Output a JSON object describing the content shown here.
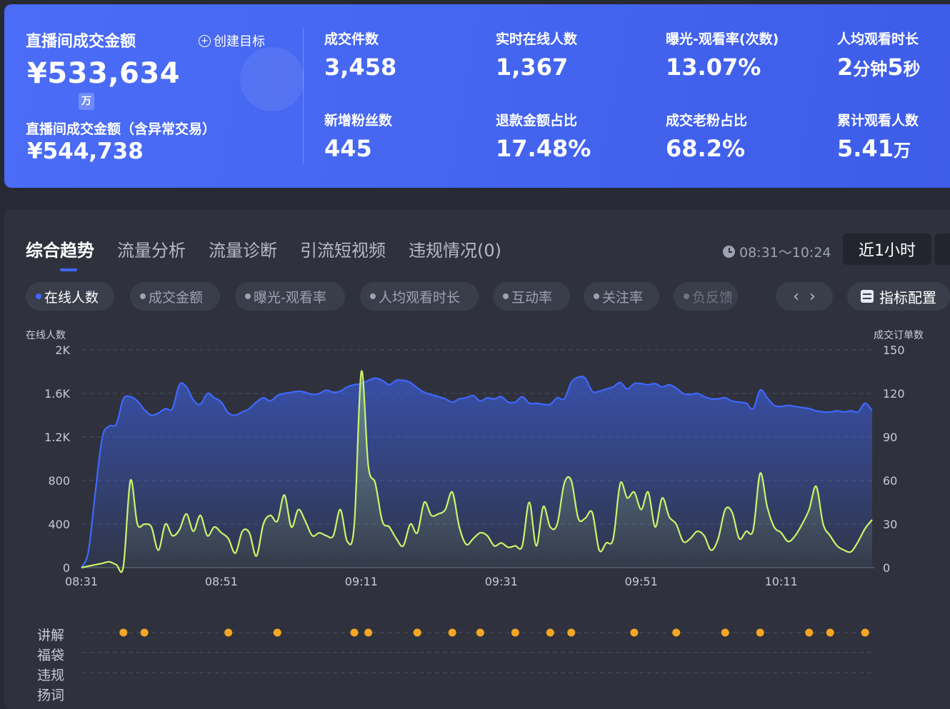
{
  "summary": {
    "main_title": "直播间成交金额",
    "create_target": "创建目标",
    "main_value": "¥533,634",
    "unit_badge": "万",
    "sub_title": "直播间成交金额（含异常交易）",
    "sub_value": "¥544,738",
    "kpis": [
      {
        "label": "成交件数",
        "value": "3,458"
      },
      {
        "label": "实时在线人数",
        "value": "1,367"
      },
      {
        "label": "曝光-观看率(次数)",
        "value": "13.07%"
      },
      {
        "label": "人均观看时长",
        "value_num1": "2",
        "value_unit1": "分钟",
        "value_num2": "5",
        "value_unit2": "秒"
      },
      {
        "label": "新增粉丝数",
        "value": "445"
      },
      {
        "label": "退款金额占比",
        "value": "17.48%"
      },
      {
        "label": "成交老粉占比",
        "value": "68.2%"
      },
      {
        "label": "累计观看人数",
        "value": "5.41",
        "unit": "万"
      }
    ]
  },
  "tabs": [
    "综合趋势",
    "流量分析",
    "流量诊断",
    "引流短视频",
    "违规情况(0)"
  ],
  "time_range": "08:31～10:24",
  "range_button": "近1小时",
  "metric_chips": [
    "在线人数",
    "成交金额",
    "曝光-观看率",
    "人均观看时长",
    "互动率",
    "关注率",
    "负反馈"
  ],
  "config_button": "指标配置",
  "nav": {
    "prev": "‹",
    "next": "›"
  },
  "chart_data": {
    "type": "line",
    "left_axis_title": "在线人数",
    "right_axis_title": "成交订单数",
    "left_ticks": [
      "0",
      "400",
      "800",
      "1.2K",
      "1.6K",
      "2K"
    ],
    "right_ticks": [
      "0",
      "30",
      "60",
      "90",
      "120",
      "150"
    ],
    "ylim_left": [
      0,
      2000
    ],
    "ylim_right": [
      0,
      150
    ],
    "x_ticks": [
      "08:31",
      "08:51",
      "09:11",
      "09:31",
      "09:51",
      "10:11"
    ],
    "x_tick_minutes": [
      0,
      20,
      40,
      60,
      80,
      100
    ],
    "x_range_minutes": [
      0,
      113
    ],
    "colors": {
      "online": "#3f67ff",
      "orders": "#c9f56a"
    },
    "series": [
      {
        "key": "online",
        "points": [
          [
            0,
            0
          ],
          [
            1,
            150
          ],
          [
            2,
            700
          ],
          [
            3,
            1200
          ],
          [
            4,
            1300
          ],
          [
            5,
            1320
          ],
          [
            6,
            1550
          ],
          [
            7,
            1570
          ],
          [
            8,
            1530
          ],
          [
            9,
            1450
          ],
          [
            10,
            1400
          ],
          [
            11,
            1420
          ],
          [
            12,
            1460
          ],
          [
            13,
            1460
          ],
          [
            14,
            1680
          ],
          [
            15,
            1660
          ],
          [
            16,
            1540
          ],
          [
            17,
            1500
          ],
          [
            18,
            1600
          ],
          [
            19,
            1560
          ],
          [
            20,
            1520
          ],
          [
            21,
            1420
          ],
          [
            22,
            1400
          ],
          [
            23,
            1430
          ],
          [
            24,
            1460
          ],
          [
            25,
            1520
          ],
          [
            26,
            1560
          ],
          [
            27,
            1530
          ],
          [
            28,
            1580
          ],
          [
            29,
            1600
          ],
          [
            30,
            1610
          ],
          [
            31,
            1620
          ],
          [
            32,
            1610
          ],
          [
            33,
            1590
          ],
          [
            34,
            1600
          ],
          [
            35,
            1630
          ],
          [
            36,
            1610
          ],
          [
            37,
            1620
          ],
          [
            38,
            1660
          ],
          [
            39,
            1680
          ],
          [
            40,
            1690
          ],
          [
            41,
            1720
          ],
          [
            42,
            1740
          ],
          [
            43,
            1720
          ],
          [
            44,
            1680
          ],
          [
            45,
            1720
          ],
          [
            46,
            1720
          ],
          [
            47,
            1700
          ],
          [
            48,
            1650
          ],
          [
            49,
            1610
          ],
          [
            50,
            1590
          ],
          [
            51,
            1570
          ],
          [
            52,
            1550
          ],
          [
            53,
            1520
          ],
          [
            54,
            1550
          ],
          [
            55,
            1560
          ],
          [
            56,
            1580
          ],
          [
            57,
            1530
          ],
          [
            58,
            1560
          ],
          [
            59,
            1550
          ],
          [
            60,
            1570
          ],
          [
            61,
            1520
          ],
          [
            62,
            1520
          ],
          [
            63,
            1570
          ],
          [
            64,
            1510
          ],
          [
            65,
            1510
          ],
          [
            66,
            1500
          ],
          [
            67,
            1500
          ],
          [
            68,
            1560
          ],
          [
            69,
            1550
          ],
          [
            70,
            1700
          ],
          [
            71,
            1750
          ],
          [
            72,
            1740
          ],
          [
            73,
            1620
          ],
          [
            74,
            1620
          ],
          [
            75,
            1640
          ],
          [
            76,
            1660
          ],
          [
            77,
            1700
          ],
          [
            78,
            1640
          ],
          [
            79,
            1690
          ],
          [
            80,
            1690
          ],
          [
            81,
            1680
          ],
          [
            82,
            1690
          ],
          [
            83,
            1660
          ],
          [
            84,
            1680
          ],
          [
            85,
            1650
          ],
          [
            86,
            1600
          ],
          [
            87,
            1590
          ],
          [
            88,
            1600
          ],
          [
            89,
            1570
          ],
          [
            90,
            1550
          ],
          [
            91,
            1550
          ],
          [
            92,
            1560
          ],
          [
            93,
            1530
          ],
          [
            94,
            1520
          ],
          [
            95,
            1510
          ],
          [
            96,
            1460
          ],
          [
            97,
            1630
          ],
          [
            98,
            1560
          ],
          [
            99,
            1490
          ],
          [
            100,
            1480
          ],
          [
            101,
            1490
          ],
          [
            102,
            1480
          ],
          [
            103,
            1470
          ],
          [
            104,
            1460
          ],
          [
            105,
            1440
          ],
          [
            106,
            1430
          ],
          [
            107,
            1430
          ],
          [
            108,
            1440
          ],
          [
            109,
            1430
          ],
          [
            110,
            1440
          ],
          [
            111,
            1430
          ],
          [
            112,
            1510
          ],
          [
            113,
            1440
          ]
        ]
      },
      {
        "key": "orders",
        "points": [
          [
            0,
            0
          ],
          [
            1,
            1
          ],
          [
            2,
            2
          ],
          [
            3,
            3
          ],
          [
            4,
            4
          ],
          [
            5,
            2
          ],
          [
            6,
            1
          ],
          [
            7,
            60
          ],
          [
            8,
            30
          ],
          [
            9,
            30
          ],
          [
            10,
            28
          ],
          [
            11,
            12
          ],
          [
            12,
            30
          ],
          [
            13,
            22
          ],
          [
            14,
            26
          ],
          [
            15,
            37
          ],
          [
            16,
            25
          ],
          [
            17,
            36
          ],
          [
            18,
            22
          ],
          [
            19,
            28
          ],
          [
            20,
            24
          ],
          [
            21,
            20
          ],
          [
            22,
            10
          ],
          [
            23,
            25
          ],
          [
            24,
            24
          ],
          [
            25,
            8
          ],
          [
            26,
            30
          ],
          [
            27,
            36
          ],
          [
            28,
            32
          ],
          [
            29,
            50
          ],
          [
            30,
            28
          ],
          [
            31,
            40
          ],
          [
            32,
            32
          ],
          [
            33,
            22
          ],
          [
            34,
            24
          ],
          [
            35,
            22
          ],
          [
            36,
            22
          ],
          [
            37,
            40
          ],
          [
            38,
            18
          ],
          [
            39,
            30
          ],
          [
            40,
            135
          ],
          [
            41,
            70
          ],
          [
            42,
            58
          ],
          [
            43,
            32
          ],
          [
            44,
            28
          ],
          [
            45,
            20
          ],
          [
            46,
            15
          ],
          [
            47,
            30
          ],
          [
            48,
            24
          ],
          [
            49,
            45
          ],
          [
            50,
            36
          ],
          [
            51,
            37
          ],
          [
            52,
            40
          ],
          [
            53,
            52
          ],
          [
            54,
            28
          ],
          [
            55,
            16
          ],
          [
            56,
            20
          ],
          [
            57,
            24
          ],
          [
            58,
            22
          ],
          [
            59,
            15
          ],
          [
            60,
            17
          ],
          [
            61,
            14
          ],
          [
            62,
            15
          ],
          [
            63,
            15
          ],
          [
            64,
            45
          ],
          [
            65,
            15
          ],
          [
            66,
            42
          ],
          [
            67,
            28
          ],
          [
            68,
            30
          ],
          [
            69,
            58
          ],
          [
            70,
            60
          ],
          [
            71,
            34
          ],
          [
            72,
            34
          ],
          [
            73,
            38
          ],
          [
            74,
            12
          ],
          [
            75,
            17
          ],
          [
            76,
            20
          ],
          [
            77,
            58
          ],
          [
            78,
            48
          ],
          [
            79,
            52
          ],
          [
            80,
            40
          ],
          [
            81,
            52
          ],
          [
            82,
            28
          ],
          [
            83,
            48
          ],
          [
            84,
            35
          ],
          [
            85,
            30
          ],
          [
            86,
            18
          ],
          [
            87,
            20
          ],
          [
            88,
            25
          ],
          [
            89,
            22
          ],
          [
            90,
            12
          ],
          [
            91,
            20
          ],
          [
            92,
            40
          ],
          [
            93,
            38
          ],
          [
            94,
            20
          ],
          [
            95,
            25
          ],
          [
            96,
            26
          ],
          [
            97,
            65
          ],
          [
            98,
            42
          ],
          [
            99,
            28
          ],
          [
            100,
            24
          ],
          [
            101,
            18
          ],
          [
            102,
            22
          ],
          [
            103,
            30
          ],
          [
            104,
            40
          ],
          [
            105,
            56
          ],
          [
            106,
            30
          ],
          [
            107,
            22
          ],
          [
            108,
            15
          ],
          [
            109,
            12
          ],
          [
            110,
            11
          ],
          [
            111,
            18
          ],
          [
            112,
            27
          ],
          [
            113,
            33
          ]
        ]
      }
    ]
  },
  "events": {
    "labels": [
      "讲解",
      "福袋",
      "违规",
      "扬词"
    ],
    "explain_minutes": [
      6,
      9,
      21,
      28,
      39,
      41,
      48,
      53,
      57,
      62,
      67,
      70,
      79,
      85,
      92,
      97,
      104,
      107,
      112
    ],
    "dot_color": "#f5a623"
  }
}
